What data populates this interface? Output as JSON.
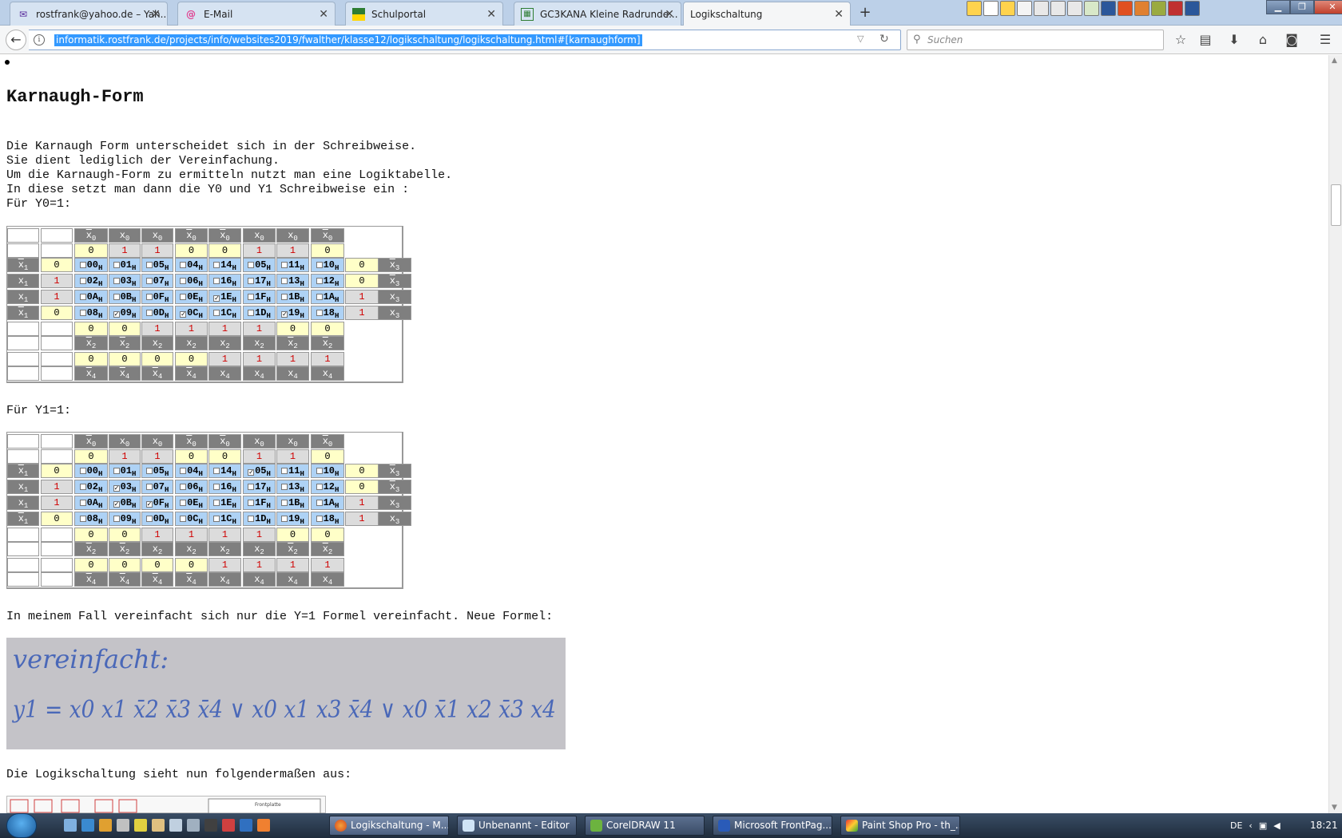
{
  "browser": {
    "tabs": [
      {
        "title": "rostfrank@yahoo.de – Yah...",
        "icon": "mail-icon",
        "active": false
      },
      {
        "title": "E-Mail",
        "icon": "at-icon",
        "active": false
      },
      {
        "title": "Schulportal",
        "icon": "crest-icon",
        "active": false
      },
      {
        "title": "GC3KANA Kleine Radrunde...",
        "icon": "geocache-icon",
        "active": false
      },
      {
        "title": "Logikschaltung",
        "icon": "",
        "active": true
      }
    ],
    "url": "informatik.rostfrank.de/projects/info/websites2019/fwalther/klasse12/logikschaltung/logikschaltung.html#[karnaughform]",
    "search_placeholder": "Suchen"
  },
  "page": {
    "heading": "Karnaugh-Form",
    "intro_lines": [
      "Die Karnaugh Form unterscheidet sich in der Schreibweise.",
      "Sie dient lediglich der Vereinfachung.",
      "Um die Karnaugh-Form zu ermitteln nutzt man eine Logiktabelle.",
      "In diese setzt man dann die Y0 und Y1 Schreibweise ein :",
      "Für Y0=1:"
    ],
    "label_y1": "Für Y1=1:",
    "simplified_text": "In meinem Fall vereinfacht sich nur die Y=1 Formel vereinfacht. Neue Formel:",
    "logic_text": "Die Logikschaltung sieht nun folgendermaßen aus:",
    "formula_image": {
      "heading_handwritten": "vereinfacht:",
      "formula_handwritten": "y1 = x0 x1 x̄2 x̄3 x̄4 ∨ x0 x1 x3 x̄4 ∨ x0 x̄1 x2 x̄3 x4"
    },
    "thumbnail_label": "Frontplatte"
  },
  "kmap": {
    "x0_bar": [
      true,
      false,
      false,
      true,
      true,
      false,
      false,
      true
    ],
    "row1": [
      "0",
      "1",
      "1",
      "0",
      "0",
      "1",
      "1",
      "0"
    ],
    "row_labels": [
      {
        "left": "x1",
        "left_bar": true,
        "v": "0",
        "rv": "0",
        "right": "x3",
        "right_bar": true
      },
      {
        "left": "x1",
        "left_bar": false,
        "v": "1",
        "rv": "0",
        "right": "x3",
        "right_bar": true
      },
      {
        "left": "x1",
        "left_bar": false,
        "v": "1",
        "rv": "1",
        "right": "x3",
        "right_bar": false
      },
      {
        "left": "x1",
        "left_bar": true,
        "v": "0",
        "rv": "1",
        "right": "x3",
        "right_bar": false
      }
    ],
    "cells": [
      [
        "00",
        "01",
        "05",
        "04",
        "14",
        "05",
        "11",
        "10"
      ],
      [
        "02",
        "03",
        "07",
        "06",
        "16",
        "17",
        "13",
        "12"
      ],
      [
        "0A",
        "0B",
        "0F",
        "0E",
        "1E",
        "1F",
        "1B",
        "1A"
      ],
      [
        "08",
        "09",
        "0D",
        "0C",
        "1C",
        "1D",
        "19",
        "18"
      ]
    ],
    "row_x2_vals": [
      "0",
      "0",
      "1",
      "1",
      "1",
      "1",
      "0",
      "0"
    ],
    "x2_bar": [
      true,
      true,
      false,
      false,
      false,
      false,
      true,
      true
    ],
    "row_x4_vals": [
      "0",
      "0",
      "0",
      "0",
      "1",
      "1",
      "1",
      "1"
    ],
    "x4_bar": [
      true,
      true,
      true,
      true,
      false,
      false,
      false,
      false
    ],
    "y0_checked": [
      [
        3,
        1
      ],
      [
        3,
        3
      ],
      [
        2,
        4
      ],
      [
        3,
        6
      ]
    ],
    "y1_checked": [
      [
        0,
        5
      ],
      [
        1,
        1
      ],
      [
        2,
        1
      ],
      [
        2,
        2
      ]
    ],
    "sub_h": "H"
  },
  "taskbar": {
    "buttons": [
      {
        "label": "Logikschaltung - M...",
        "icon": "firefox-icon",
        "active": true
      },
      {
        "label": "Unbenannt - Editor",
        "icon": "notepad-icon",
        "active": false
      },
      {
        "label": "CorelDRAW 11",
        "icon": "coreldraw-icon",
        "active": false
      },
      {
        "label": "Microsoft FrontPag...",
        "icon": "frontpage-icon",
        "active": false
      },
      {
        "label": "Paint Shop Pro - th_...",
        "icon": "paintshop-icon",
        "active": false
      }
    ],
    "language": "DE",
    "clock": "18:21"
  }
}
